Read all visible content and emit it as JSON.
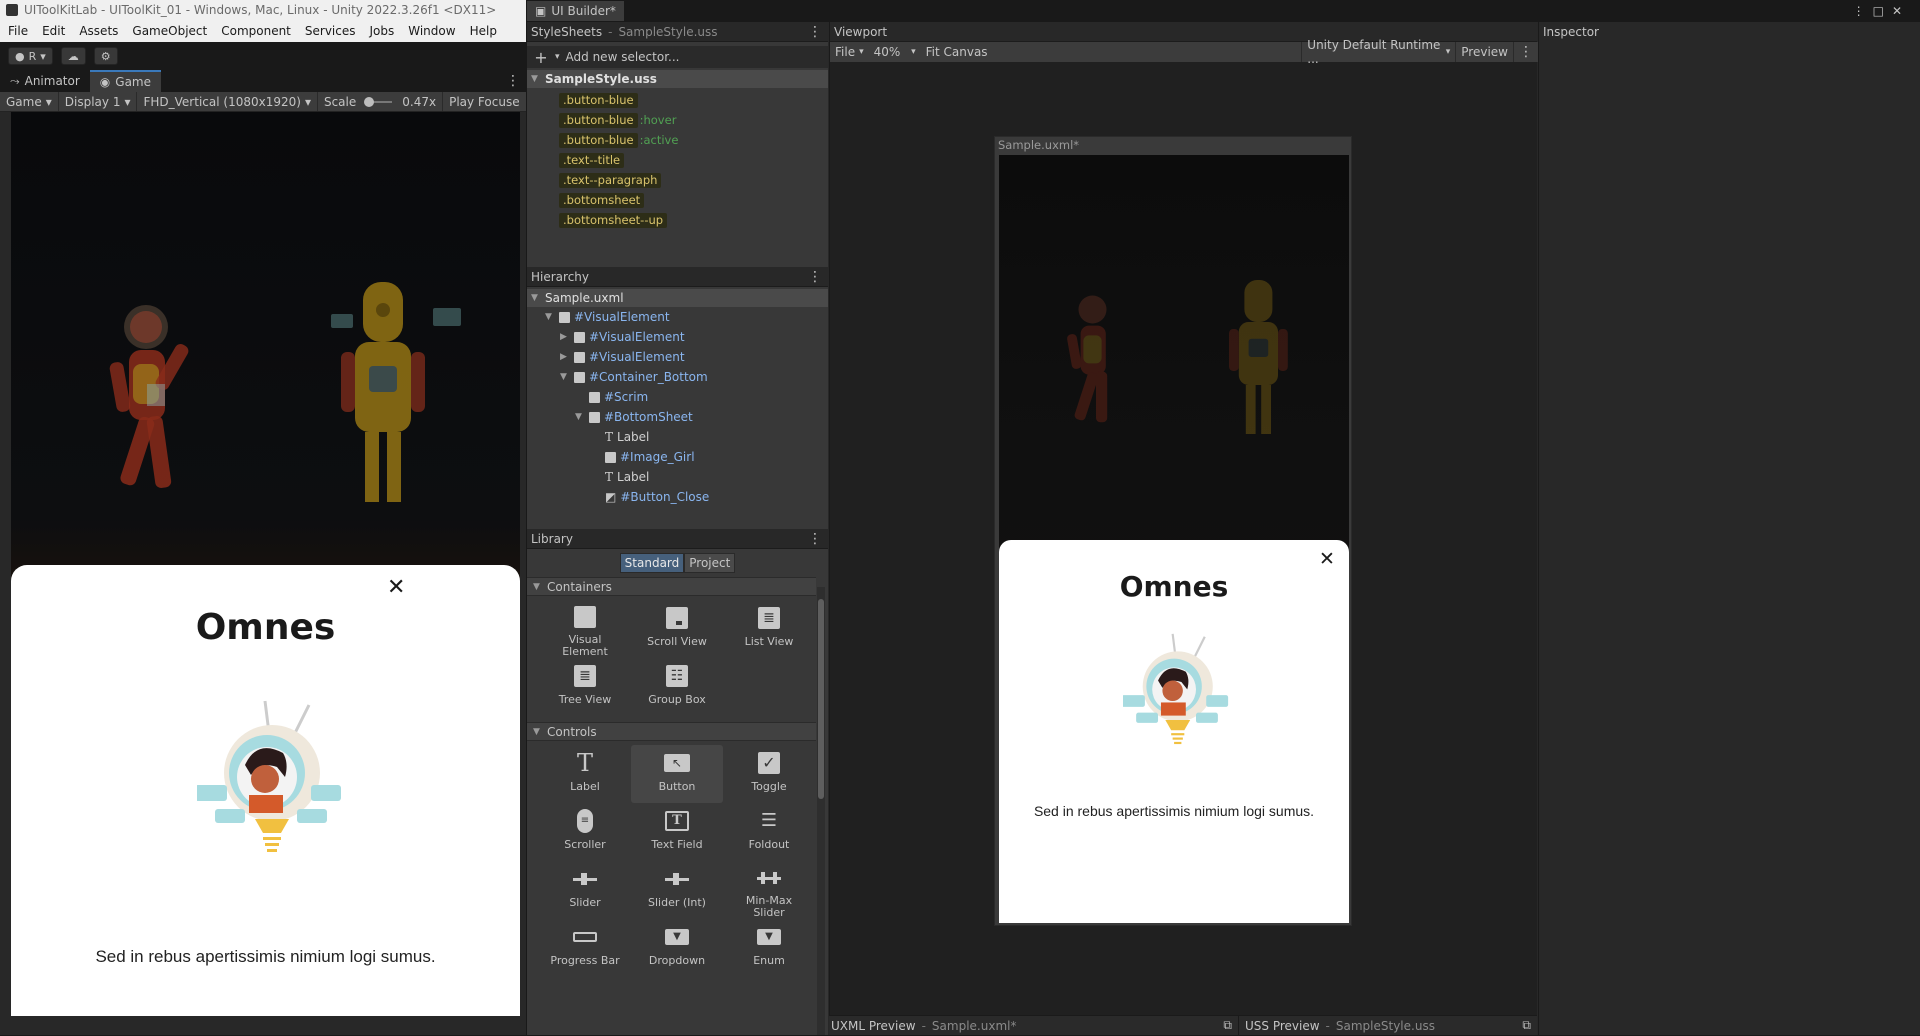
{
  "unity": {
    "title": "UIToolKitLab - UIToolKit_01 - Windows, Mac, Linux - Unity 2022.3.26f1 <DX11>",
    "menu": [
      "File",
      "Edit",
      "Assets",
      "GameObject",
      "Component",
      "Services",
      "Jobs",
      "Window",
      "Help"
    ],
    "account": "R",
    "tabs": {
      "animator": "Animator",
      "game": "Game"
    },
    "game_bar": {
      "mode": "Game",
      "display": "Display 1",
      "resolution": "FHD_Vertical (1080x1920)",
      "scale_label": "Scale",
      "scale_value": "0.47x",
      "play_focus": "Play Focuse"
    },
    "sheet": {
      "title": "Omnes",
      "text": "Sed in rebus apertissimis nimium logi sumus."
    }
  },
  "builder": {
    "window_tab": "UI Builder*",
    "stylesheets": {
      "title": "StyleSheets",
      "subtitle": "SampleStyle.uss",
      "add_placeholder": "Add new selector...",
      "file": "SampleStyle.uss",
      "selectors": [
        {
          "name": ".button-blue",
          "pseudo": ""
        },
        {
          "name": ".button-blue",
          "pseudo": ":hover"
        },
        {
          "name": ".button-blue",
          "pseudo": ":active"
        },
        {
          "name": ".text--title",
          "pseudo": ""
        },
        {
          "name": ".text--paragraph",
          "pseudo": ""
        },
        {
          "name": ".bottomsheet",
          "pseudo": ""
        },
        {
          "name": ".bottomsheet--up",
          "pseudo": ""
        }
      ]
    },
    "hierarchy": {
      "title": "Hierarchy",
      "root": "Sample.uxml",
      "items": [
        {
          "label": "#VisualElement",
          "indent": 1,
          "arrow": "open",
          "icon": "box"
        },
        {
          "label": "#VisualElement",
          "indent": 2,
          "arrow": "closed",
          "icon": "box"
        },
        {
          "label": "#VisualElement",
          "indent": 2,
          "arrow": "closed",
          "icon": "box"
        },
        {
          "label": "#Container_Bottom",
          "indent": 2,
          "arrow": "open",
          "icon": "box"
        },
        {
          "label": "#Scrim",
          "indent": 3,
          "arrow": "",
          "icon": "box"
        },
        {
          "label": "#BottomSheet",
          "indent": 3,
          "arrow": "open",
          "icon": "box"
        },
        {
          "label": "Label",
          "indent": 4,
          "arrow": "",
          "icon": "text"
        },
        {
          "label": "#Image_Girl",
          "indent": 4,
          "arrow": "",
          "icon": "box"
        },
        {
          "label": "Label",
          "indent": 4,
          "arrow": "",
          "icon": "text"
        },
        {
          "label": "#Button_Close",
          "indent": 4,
          "arrow": "",
          "icon": "button"
        }
      ]
    },
    "library": {
      "title": "Library",
      "tab_standard": "Standard",
      "tab_project": "Project",
      "containers_label": "Containers",
      "controls_label": "Controls",
      "containers": [
        "Visual Element",
        "Scroll View",
        "List View",
        "Tree View",
        "Group Box"
      ],
      "controls": [
        "Label",
        "Button",
        "Toggle",
        "Scroller",
        "Text Field",
        "Foldout",
        "Slider",
        "Slider (Int)",
        "Min-Max Slider",
        "Progress Bar",
        "Dropdown",
        "Enum"
      ]
    },
    "viewport": {
      "title": "Viewport",
      "file_menu": "File",
      "zoom": "40%",
      "fit": "Fit Canvas",
      "theme": "Unity Default Runtime ...",
      "preview": "Preview",
      "canvas_label": "Sample.uxml*",
      "sheet": {
        "title": "Omnes",
        "text": "Sed in rebus apertissimis nimium logi sumus."
      }
    },
    "inspector": {
      "title": "Inspector"
    },
    "uxml_preview": {
      "label": "UXML Preview",
      "file": "Sample.uxml*"
    },
    "uss_preview": {
      "label": "USS Preview",
      "file": "SampleStyle.uss"
    }
  }
}
